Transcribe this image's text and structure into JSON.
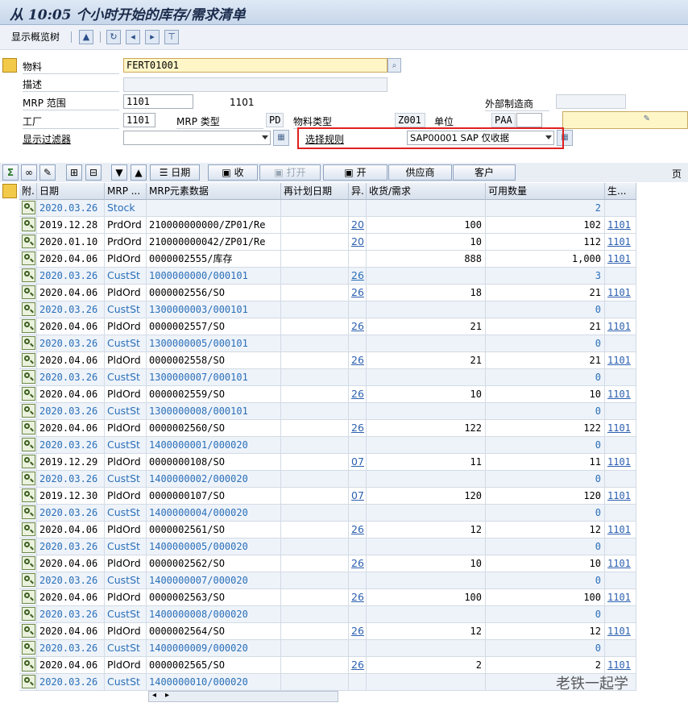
{
  "window": {
    "title": "从 10:05 个小时开始的库存/需求清单"
  },
  "toolbar": {
    "show_tree_label": "显示概览树"
  },
  "form": {
    "material_label": "物料",
    "material_value": "FERT01001",
    "desc_label": "描述",
    "mrp_area_label": "MRP 范围",
    "mrp_area_value": "1101",
    "mrp_area_text": "1101",
    "ext_mfr_label": "外部制造商",
    "plant_label": "工厂",
    "plant_value": "1101",
    "mrp_type_label": "MRP 类型",
    "mrp_type_value": "PD",
    "mat_type_label": "物料类型",
    "mat_type_value": "Z001",
    "unit_label": "单位",
    "unit_value": "PAA",
    "filter_label": "显示过滤器",
    "selrule_label": "选择规则",
    "selrule_value": "SAP00001 SAP 仅收据"
  },
  "buttons": {
    "date": "日期",
    "receipts": "收",
    "open": "打开",
    "open2": "开",
    "vendor": "供应商",
    "customer": "客户",
    "page": "页"
  },
  "columns": [
    "附.",
    "日期",
    "MRP ...",
    "MRP元素数据",
    "再计划日期",
    "异.",
    "收货/需求",
    "可用数量",
    "生..."
  ],
  "rows": [
    {
      "s": "b",
      "date": "2020.03.26",
      "mrp": "Stock",
      "elem": "",
      "exc": "",
      "qty": "",
      "avail": "2",
      "plant": ""
    },
    {
      "s": "w",
      "date": "2019.12.28",
      "mrp": "PrdOrd",
      "elem": "210000000000/ZP01/Re",
      "exc": "20",
      "qty": "100",
      "avail": "102",
      "plant": "1101"
    },
    {
      "s": "w",
      "date": "2020.01.10",
      "mrp": "PrdOrd",
      "elem": "210000000042/ZP01/Re",
      "exc": "20",
      "qty": "10",
      "avail": "112",
      "plant": "1101"
    },
    {
      "s": "w",
      "date": "2020.04.06",
      "mrp": "PldOrd",
      "elem": "0000002555/库存",
      "exc": "",
      "qty": "888",
      "avail": "1,000",
      "plant": "1101"
    },
    {
      "s": "b",
      "date": "2020.03.26",
      "mrp": "CustSt",
      "elem": "1000000000/000101",
      "exc": "26",
      "qty": "",
      "avail": "3",
      "plant": ""
    },
    {
      "s": "w",
      "date": "2020.04.06",
      "mrp": "PldOrd",
      "elem": "0000002556/SO",
      "exc": "26",
      "qty": "18",
      "avail": "21",
      "plant": "1101"
    },
    {
      "s": "b",
      "date": "2020.03.26",
      "mrp": "CustSt",
      "elem": "1300000003/000101",
      "exc": "",
      "qty": "",
      "avail": "0",
      "plant": ""
    },
    {
      "s": "w",
      "date": "2020.04.06",
      "mrp": "PldOrd",
      "elem": "0000002557/SO",
      "exc": "26",
      "qty": "21",
      "avail": "21",
      "plant": "1101"
    },
    {
      "s": "b",
      "date": "2020.03.26",
      "mrp": "CustSt",
      "elem": "1300000005/000101",
      "exc": "",
      "qty": "",
      "avail": "0",
      "plant": ""
    },
    {
      "s": "w",
      "date": "2020.04.06",
      "mrp": "PldOrd",
      "elem": "0000002558/SO",
      "exc": "26",
      "qty": "21",
      "avail": "21",
      "plant": "1101"
    },
    {
      "s": "b",
      "date": "2020.03.26",
      "mrp": "CustSt",
      "elem": "1300000007/000101",
      "exc": "",
      "qty": "",
      "avail": "0",
      "plant": ""
    },
    {
      "s": "w",
      "date": "2020.04.06",
      "mrp": "PldOrd",
      "elem": "0000002559/SO",
      "exc": "26",
      "qty": "10",
      "avail": "10",
      "plant": "1101"
    },
    {
      "s": "b",
      "date": "2020.03.26",
      "mrp": "CustSt",
      "elem": "1300000008/000101",
      "exc": "",
      "qty": "",
      "avail": "0",
      "plant": ""
    },
    {
      "s": "w",
      "date": "2020.04.06",
      "mrp": "PldOrd",
      "elem": "0000002560/SO",
      "exc": "26",
      "qty": "122",
      "avail": "122",
      "plant": "1101"
    },
    {
      "s": "b",
      "date": "2020.03.26",
      "mrp": "CustSt",
      "elem": "1400000001/000020",
      "exc": "",
      "qty": "",
      "avail": "0",
      "plant": ""
    },
    {
      "s": "w",
      "date": "2019.12.29",
      "mrp": "PldOrd",
      "elem": "0000000108/SO",
      "exc": "07",
      "qty": "11",
      "avail": "11",
      "plant": "1101"
    },
    {
      "s": "b",
      "date": "2020.03.26",
      "mrp": "CustSt",
      "elem": "1400000002/000020",
      "exc": "",
      "qty": "",
      "avail": "0",
      "plant": ""
    },
    {
      "s": "w",
      "date": "2019.12.30",
      "mrp": "PldOrd",
      "elem": "0000000107/SO",
      "exc": "07",
      "qty": "120",
      "avail": "120",
      "plant": "1101"
    },
    {
      "s": "b",
      "date": "2020.03.26",
      "mrp": "CustSt",
      "elem": "1400000004/000020",
      "exc": "",
      "qty": "",
      "avail": "0",
      "plant": ""
    },
    {
      "s": "w",
      "date": "2020.04.06",
      "mrp": "PldOrd",
      "elem": "0000002561/SO",
      "exc": "26",
      "qty": "12",
      "avail": "12",
      "plant": "1101"
    },
    {
      "s": "b",
      "date": "2020.03.26",
      "mrp": "CustSt",
      "elem": "1400000005/000020",
      "exc": "",
      "qty": "",
      "avail": "0",
      "plant": ""
    },
    {
      "s": "w",
      "date": "2020.04.06",
      "mrp": "PldOrd",
      "elem": "0000002562/SO",
      "exc": "26",
      "qty": "10",
      "avail": "10",
      "plant": "1101"
    },
    {
      "s": "b",
      "date": "2020.03.26",
      "mrp": "CustSt",
      "elem": "1400000007/000020",
      "exc": "",
      "qty": "",
      "avail": "0",
      "plant": ""
    },
    {
      "s": "w",
      "date": "2020.04.06",
      "mrp": "PldOrd",
      "elem": "0000002563/SO",
      "exc": "26",
      "qty": "100",
      "avail": "100",
      "plant": "1101"
    },
    {
      "s": "b",
      "date": "2020.03.26",
      "mrp": "CustSt",
      "elem": "1400000008/000020",
      "exc": "",
      "qty": "",
      "avail": "0",
      "plant": ""
    },
    {
      "s": "w",
      "date": "2020.04.06",
      "mrp": "PldOrd",
      "elem": "0000002564/SO",
      "exc": "26",
      "qty": "12",
      "avail": "12",
      "plant": "1101"
    },
    {
      "s": "b",
      "date": "2020.03.26",
      "mrp": "CustSt",
      "elem": "1400000009/000020",
      "exc": "",
      "qty": "",
      "avail": "0",
      "plant": ""
    },
    {
      "s": "w",
      "date": "2020.04.06",
      "mrp": "PldOrd",
      "elem": "0000002565/SO",
      "exc": "26",
      "qty": "2",
      "avail": "2",
      "plant": "1101"
    },
    {
      "s": "b",
      "date": "2020.03.26",
      "mrp": "CustSt",
      "elem": "1400000010/000020",
      "exc": "",
      "qty": "",
      "avail": "",
      "plant": ""
    }
  ],
  "watermark": "老铁一起学",
  "colors": {
    "link": "#2a5fb0",
    "stock_row_text": "#2a6fb8",
    "highlight_box": "#e02020"
  }
}
